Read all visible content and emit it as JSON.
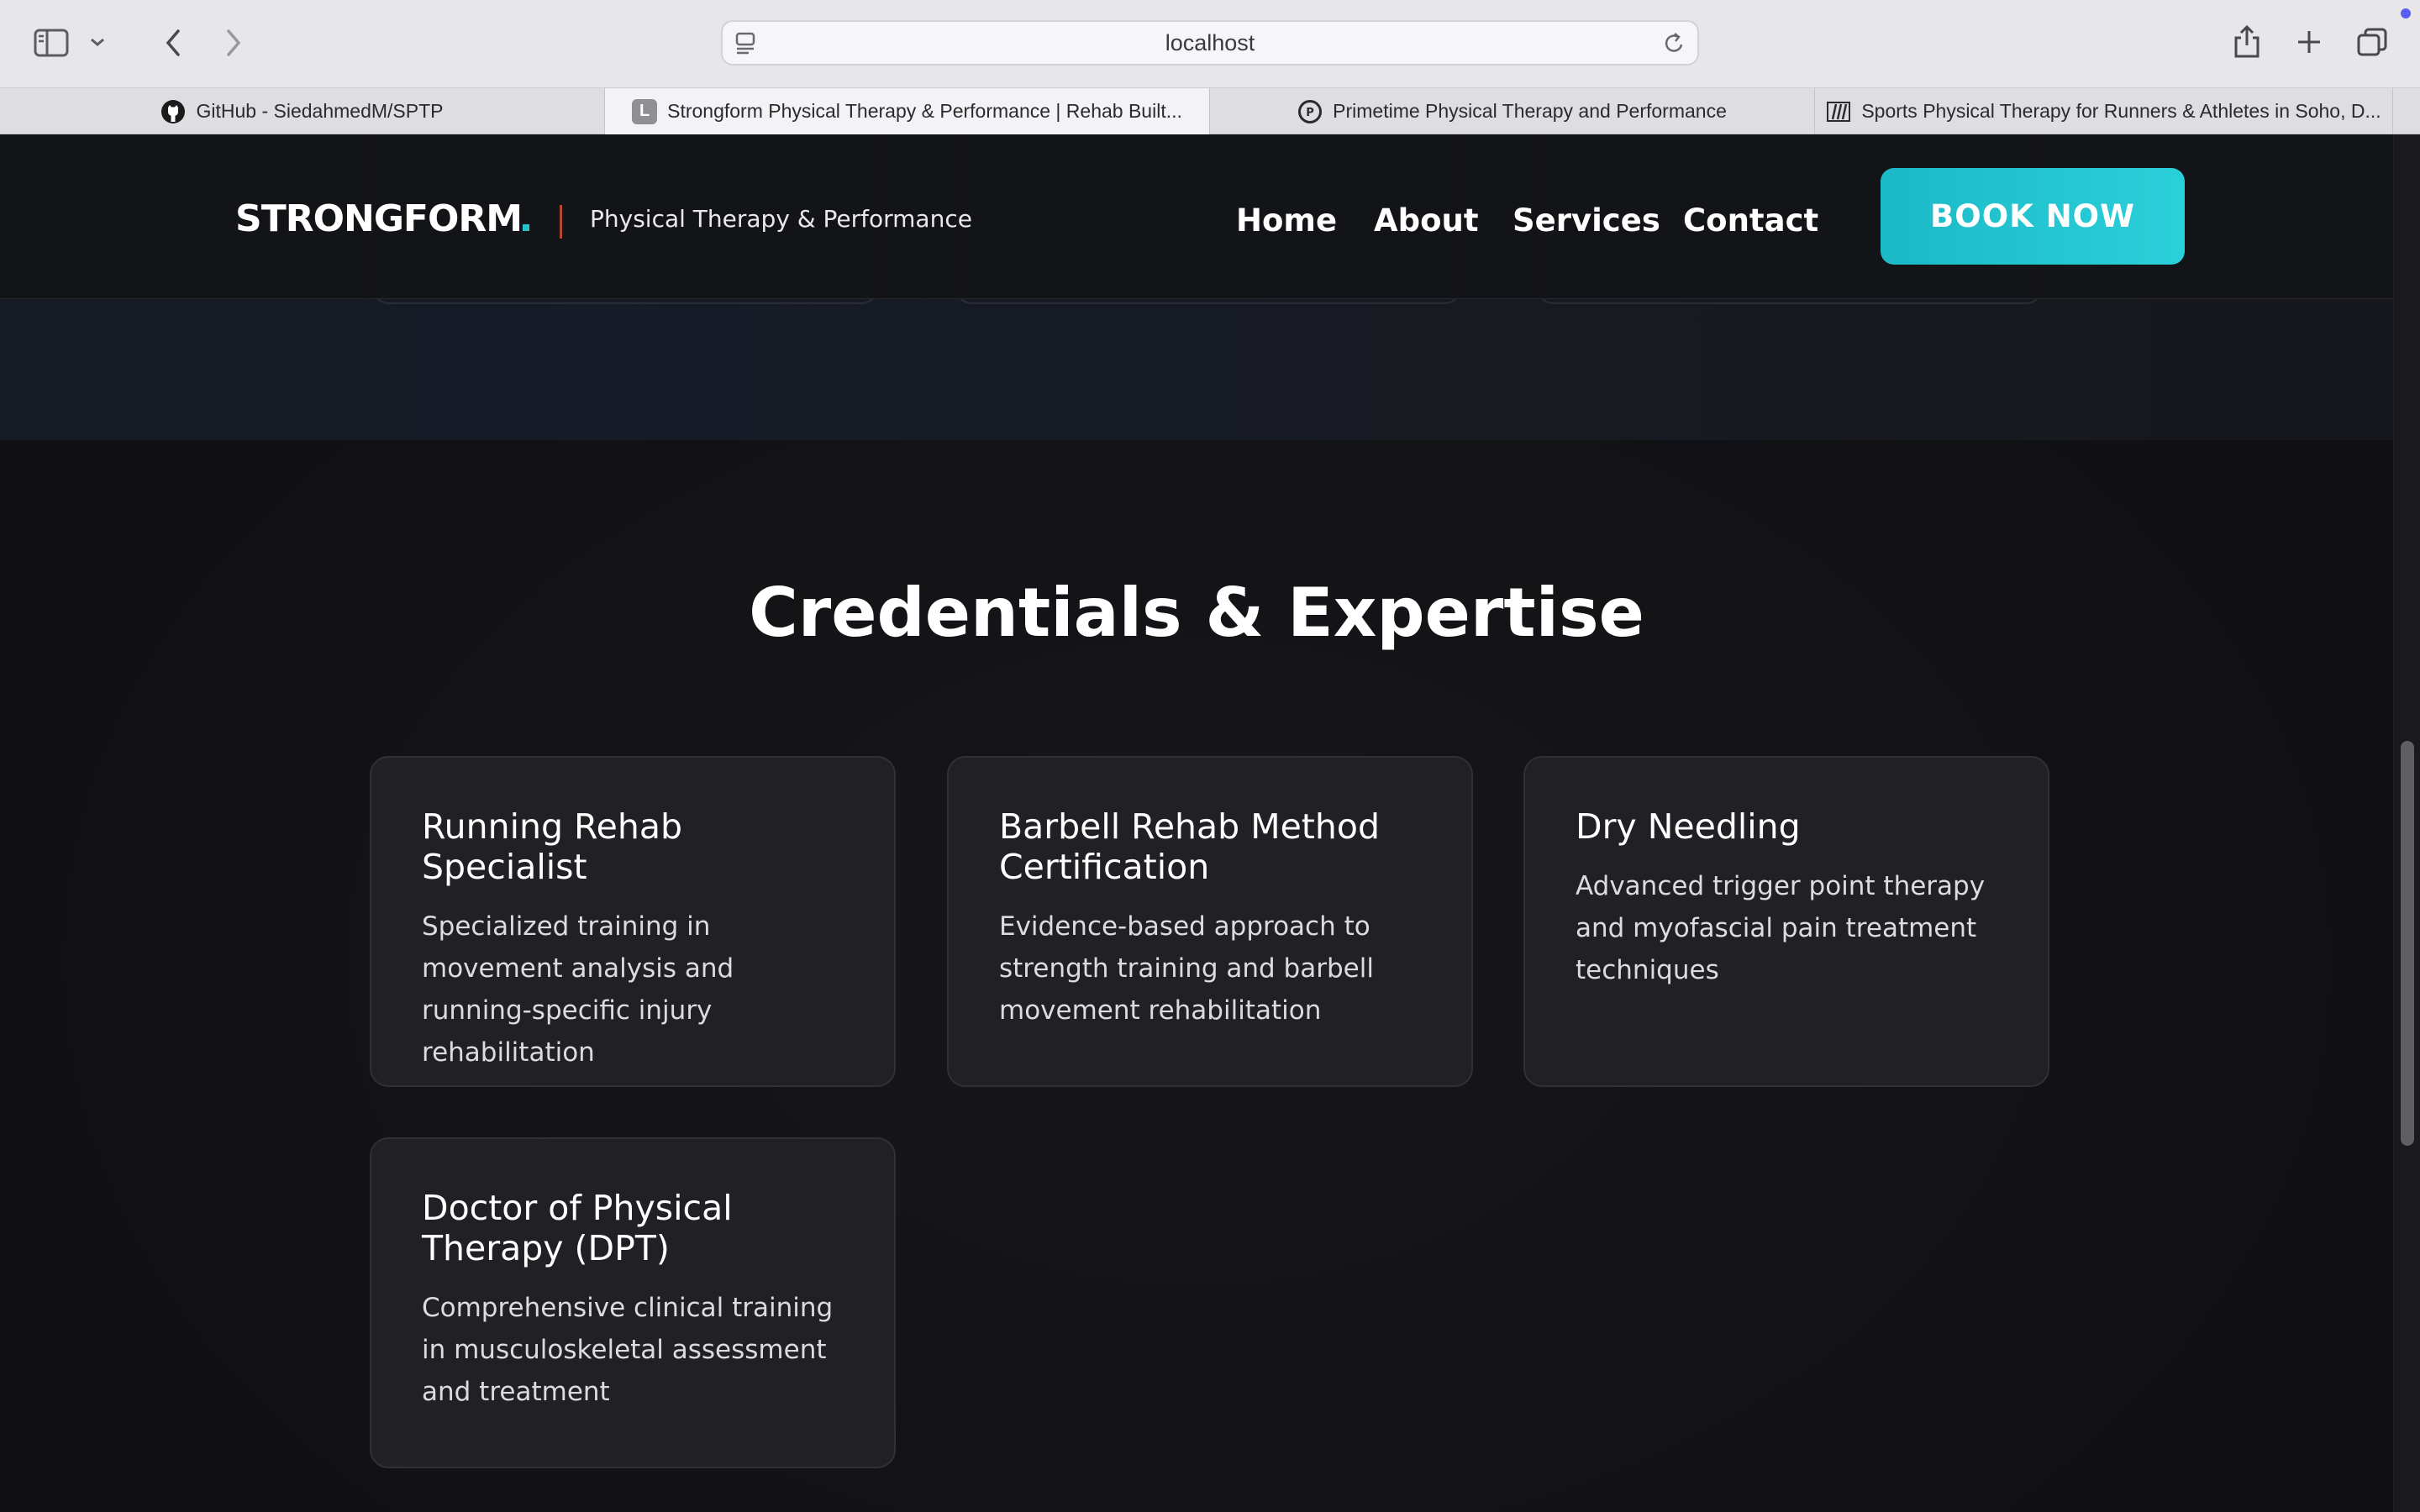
{
  "browser": {
    "address": "localhost",
    "tabs": [
      {
        "title": "GitHub - SiedahmedM/SPTP",
        "active": false
      },
      {
        "title": "Strongform Physical Therapy & Performance | Rehab Built...",
        "active": true
      },
      {
        "title": "Primetime Physical Therapy and Performance",
        "active": false
      },
      {
        "title": "Sports Physical Therapy for Runners & Athletes in Soho, D...",
        "active": false
      }
    ],
    "favicon_letter": "L"
  },
  "nav": {
    "logo": "STRONGFORM",
    "tagline": "Physical Therapy & Performance",
    "links": [
      "Home",
      "About",
      "Services",
      "Contact"
    ],
    "cta": "BOOK NOW"
  },
  "credentials": {
    "title": "Credentials & Expertise",
    "cards": [
      {
        "title": "Running Rehab Specialist",
        "desc": "Specialized training in movement analysis and running-specific injury rehabilitation"
      },
      {
        "title": "Barbell Rehab Method Certification",
        "desc": "Evidence-based approach to strength training and barbell movement rehabilitation"
      },
      {
        "title": "Dry Needling",
        "desc": "Advanced trigger point therapy and myofascial pain treatment techniques"
      },
      {
        "title": "Doctor of Physical Therapy (DPT)",
        "desc": "Comprehensive clinical training in musculoskeletal assessment and treatment"
      }
    ]
  },
  "colors": {
    "accent": "#22c3cf",
    "page_bg": "#131316",
    "card_bg": "#212125"
  },
  "icons": [
    "sidebar-icon",
    "chevron-down-icon",
    "back-icon",
    "forward-icon",
    "page-menu-icon",
    "reload-icon",
    "share-icon",
    "new-tab-icon",
    "tab-overview-icon",
    "github-icon",
    "primetime-icon",
    "sports-pt-icon"
  ]
}
